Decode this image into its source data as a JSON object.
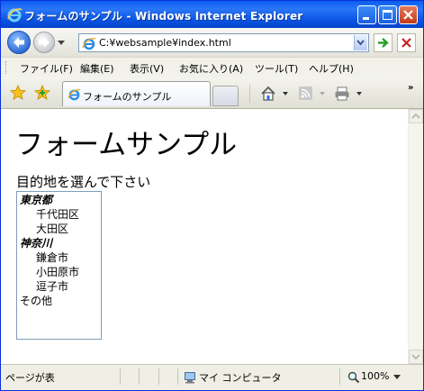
{
  "window": {
    "title": "フォームのサンプル - Windows Internet Explorer"
  },
  "address_bar": {
    "url": "C:¥websample¥index.html"
  },
  "menu": {
    "items": [
      "ファイル(F)",
      "編集(E)",
      "表示(V)",
      "お気に入り(A)",
      "ツール(T)",
      "ヘルプ(H)"
    ]
  },
  "tab": {
    "label": "フォームのサンプル"
  },
  "page": {
    "heading": "フォームサンプル",
    "prompt": "目的地を選んで下さい",
    "listbox": {
      "groups": [
        {
          "label": "東京都",
          "options": [
            "千代田区",
            "大田区"
          ]
        },
        {
          "label": "神奈川",
          "options": [
            "鎌倉市",
            "小田原市",
            "逗子市"
          ]
        }
      ],
      "extra_option": "その他"
    }
  },
  "status": {
    "left": "ページが表",
    "zone": "マイ コンピュータ",
    "zoom": "100%"
  },
  "colors": {
    "titlebar": "#0a5ef0",
    "frame": "#0831d9"
  }
}
